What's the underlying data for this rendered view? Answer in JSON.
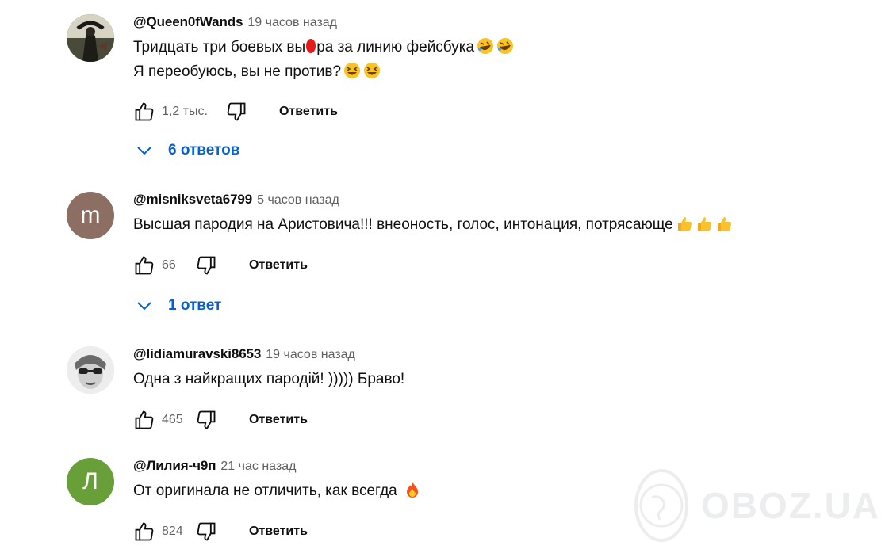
{
  "comments": [
    {
      "handle": "@Queen0fWands",
      "time": "19 часов назад",
      "lines": [
        "Тридцать три боевых вы",
        "ра за линию фейсбука",
        "Я переобуюсь, вы не против?"
      ],
      "likes": "1,2 тыс.",
      "reply_label": "Ответить",
      "replies_label": "6 ответов",
      "avatar_kind": "photo-dark"
    },
    {
      "handle": "@misniksveta6799",
      "time": "5 часов назад",
      "text": "Высшая пародия на Аристовича!!! внеоность, голос, интонация, потрясающе",
      "likes": "66",
      "reply_label": "Ответить",
      "replies_label": "1 ответ",
      "avatar_letter": "m",
      "avatar_color": "#8d6e63"
    },
    {
      "handle": "@lidiamuravski8653",
      "time": "19 часов назад",
      "text": "Одна з найкращих пародій! ))))) Браво!",
      "likes": "465",
      "reply_label": "Ответить",
      "avatar_kind": "photo-light"
    },
    {
      "handle": "@Лилия-ч9п",
      "time": "21 час назад",
      "text": "От оригинала не отличить, как всегда",
      "likes": "824",
      "reply_label": "Ответить",
      "avatar_letter": "Л",
      "avatar_color": "#689f38"
    }
  ],
  "icons": {
    "like": "thumbs-up-icon",
    "dislike": "thumbs-down-icon",
    "expand": "chevron-down-icon",
    "laugh_emoji": "rolling-laughing-emoji",
    "grin_emoji": "grinning-squinting-emoji",
    "thumbs_emoji": "thumbs-up-emoji",
    "fire_emoji": "fire-emoji"
  },
  "colors": {
    "link_blue": "#065fd4",
    "meta_gray": "#606060",
    "text": "#0f0f0f"
  },
  "watermark": "OBOZ.UA"
}
